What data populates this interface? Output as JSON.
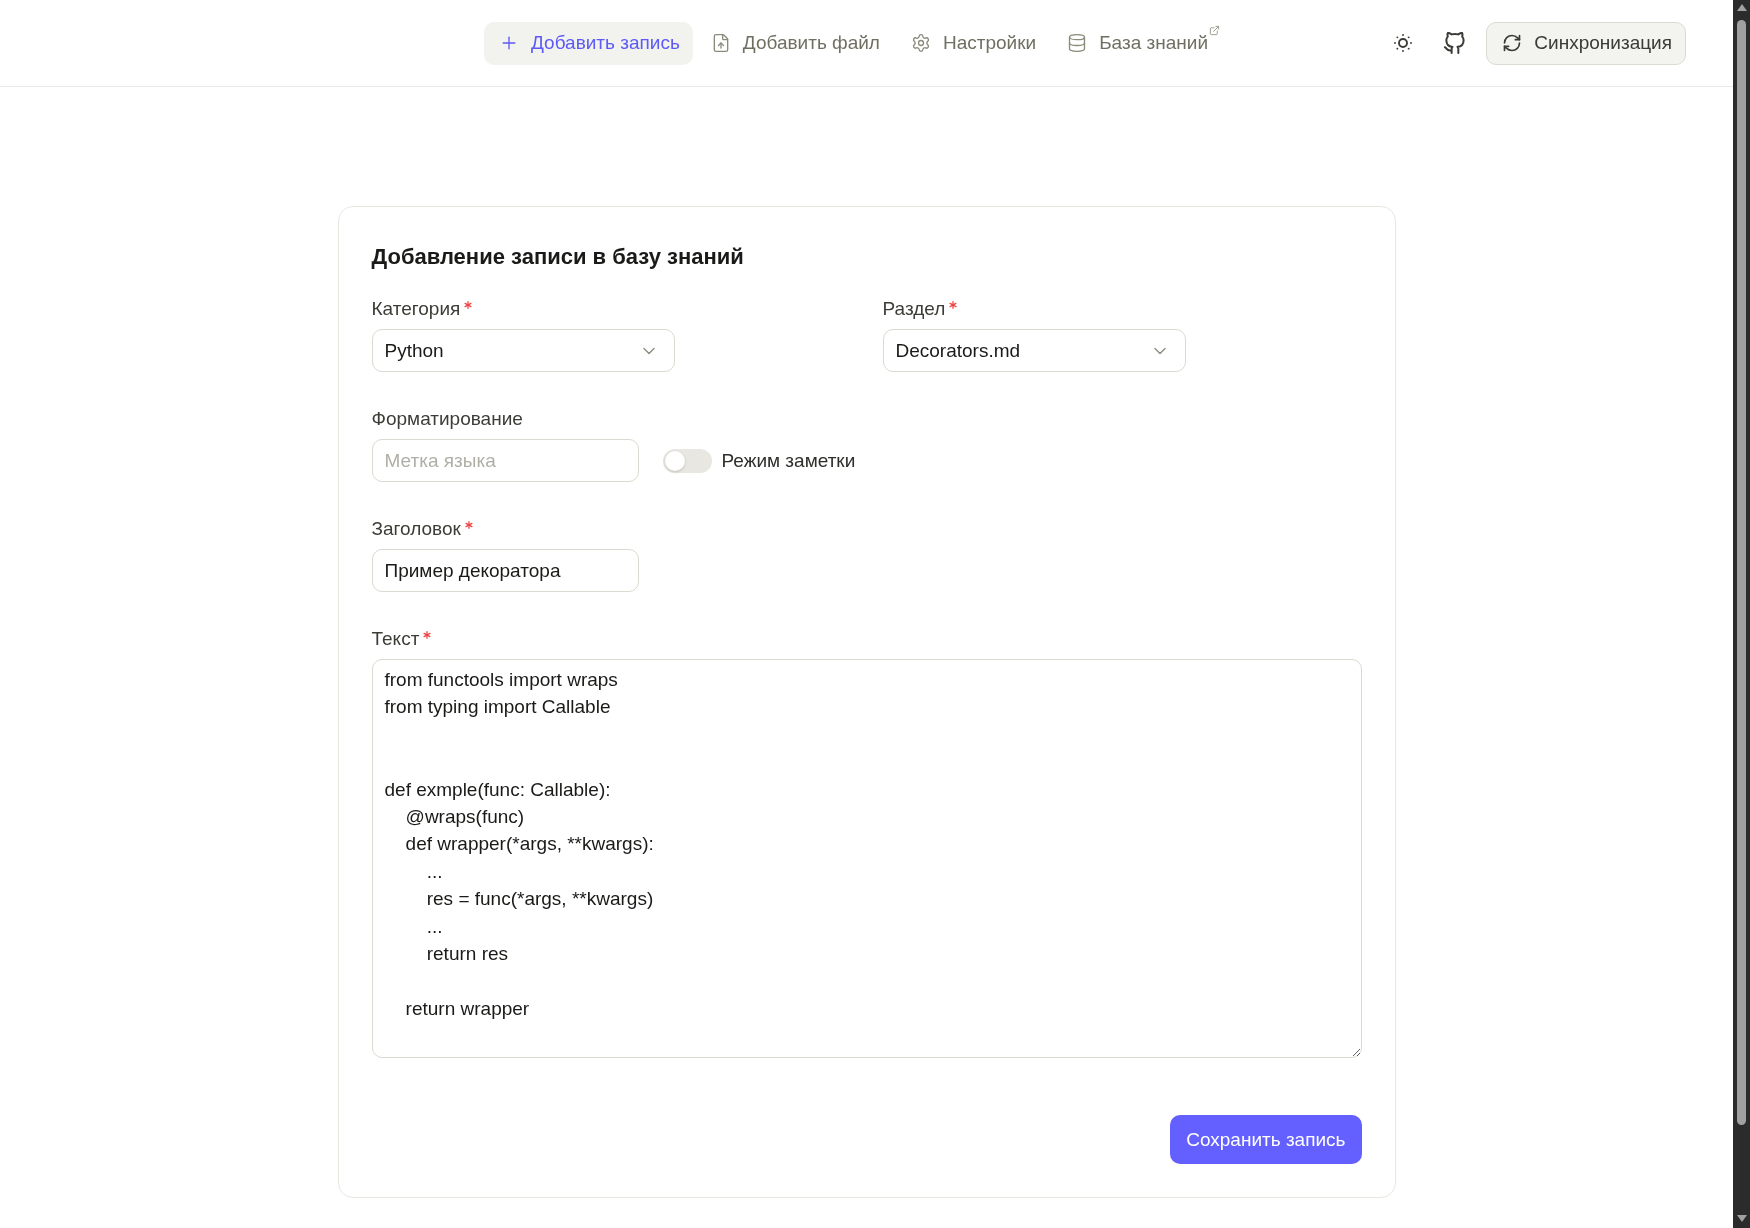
{
  "nav": {
    "items": [
      {
        "label": "Добавить запись",
        "selected": true,
        "external": false
      },
      {
        "label": "Добавить файл",
        "selected": false,
        "external": false
      },
      {
        "label": "Настройки",
        "selected": false,
        "external": false
      },
      {
        "label": "База знаний",
        "selected": false,
        "external": true
      }
    ],
    "sync_button": "Синхронизация"
  },
  "form": {
    "title": "Добавление записи в базу знаний",
    "category": {
      "label": "Категория",
      "required": true,
      "value": "Python"
    },
    "section": {
      "label": "Раздел",
      "required": true,
      "value": "Decorators.md"
    },
    "formatting": {
      "label": "Форматирование",
      "required": false,
      "placeholder": "Метка языка",
      "note_mode": {
        "label": "Режим заметки",
        "on": false
      }
    },
    "heading": {
      "label": "Заголовок",
      "required": true,
      "value": "Пример декоратора"
    },
    "text": {
      "label": "Текст",
      "required": true,
      "value": "from functools import wraps\nfrom typing import Callable\n\n\ndef exmple(func: Callable):\n    @wraps(func)\n    def wrapper(*args, **kwargs):\n        ...\n        res = func(*args, **kwargs)\n        ...\n        return res\n\n    return wrapper"
    },
    "submit": "Сохранить запись"
  }
}
